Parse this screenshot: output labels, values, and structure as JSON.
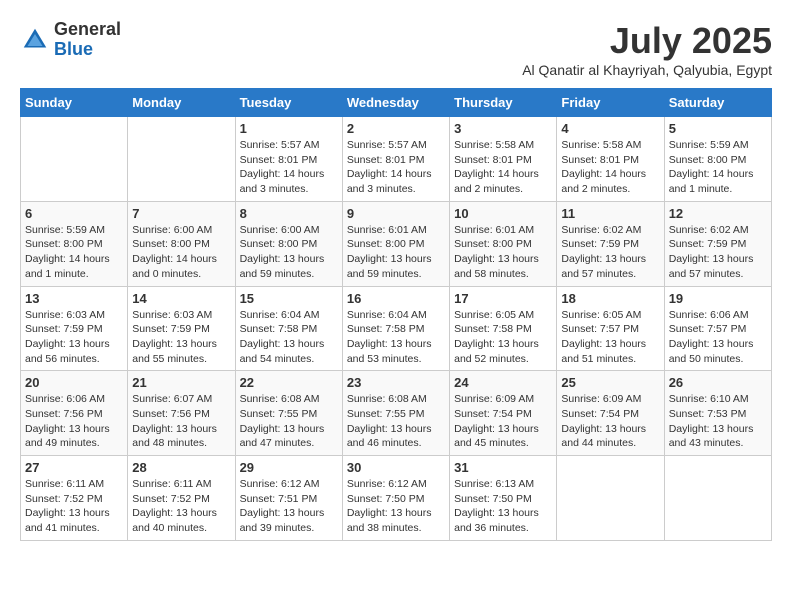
{
  "header": {
    "logo_general": "General",
    "logo_blue": "Blue",
    "month": "July 2025",
    "location": "Al Qanatir al Khayriyah, Qalyubia, Egypt"
  },
  "days_of_week": [
    "Sunday",
    "Monday",
    "Tuesday",
    "Wednesday",
    "Thursday",
    "Friday",
    "Saturday"
  ],
  "weeks": [
    [
      {
        "day": "",
        "info": ""
      },
      {
        "day": "",
        "info": ""
      },
      {
        "day": "1",
        "info": "Sunrise: 5:57 AM\nSunset: 8:01 PM\nDaylight: 14 hours and 3 minutes."
      },
      {
        "day": "2",
        "info": "Sunrise: 5:57 AM\nSunset: 8:01 PM\nDaylight: 14 hours and 3 minutes."
      },
      {
        "day": "3",
        "info": "Sunrise: 5:58 AM\nSunset: 8:01 PM\nDaylight: 14 hours and 2 minutes."
      },
      {
        "day": "4",
        "info": "Sunrise: 5:58 AM\nSunset: 8:01 PM\nDaylight: 14 hours and 2 minutes."
      },
      {
        "day": "5",
        "info": "Sunrise: 5:59 AM\nSunset: 8:00 PM\nDaylight: 14 hours and 1 minute."
      }
    ],
    [
      {
        "day": "6",
        "info": "Sunrise: 5:59 AM\nSunset: 8:00 PM\nDaylight: 14 hours and 1 minute."
      },
      {
        "day": "7",
        "info": "Sunrise: 6:00 AM\nSunset: 8:00 PM\nDaylight: 14 hours and 0 minutes."
      },
      {
        "day": "8",
        "info": "Sunrise: 6:00 AM\nSunset: 8:00 PM\nDaylight: 13 hours and 59 minutes."
      },
      {
        "day": "9",
        "info": "Sunrise: 6:01 AM\nSunset: 8:00 PM\nDaylight: 13 hours and 59 minutes."
      },
      {
        "day": "10",
        "info": "Sunrise: 6:01 AM\nSunset: 8:00 PM\nDaylight: 13 hours and 58 minutes."
      },
      {
        "day": "11",
        "info": "Sunrise: 6:02 AM\nSunset: 7:59 PM\nDaylight: 13 hours and 57 minutes."
      },
      {
        "day": "12",
        "info": "Sunrise: 6:02 AM\nSunset: 7:59 PM\nDaylight: 13 hours and 57 minutes."
      }
    ],
    [
      {
        "day": "13",
        "info": "Sunrise: 6:03 AM\nSunset: 7:59 PM\nDaylight: 13 hours and 56 minutes."
      },
      {
        "day": "14",
        "info": "Sunrise: 6:03 AM\nSunset: 7:59 PM\nDaylight: 13 hours and 55 minutes."
      },
      {
        "day": "15",
        "info": "Sunrise: 6:04 AM\nSunset: 7:58 PM\nDaylight: 13 hours and 54 minutes."
      },
      {
        "day": "16",
        "info": "Sunrise: 6:04 AM\nSunset: 7:58 PM\nDaylight: 13 hours and 53 minutes."
      },
      {
        "day": "17",
        "info": "Sunrise: 6:05 AM\nSunset: 7:58 PM\nDaylight: 13 hours and 52 minutes."
      },
      {
        "day": "18",
        "info": "Sunrise: 6:05 AM\nSunset: 7:57 PM\nDaylight: 13 hours and 51 minutes."
      },
      {
        "day": "19",
        "info": "Sunrise: 6:06 AM\nSunset: 7:57 PM\nDaylight: 13 hours and 50 minutes."
      }
    ],
    [
      {
        "day": "20",
        "info": "Sunrise: 6:06 AM\nSunset: 7:56 PM\nDaylight: 13 hours and 49 minutes."
      },
      {
        "day": "21",
        "info": "Sunrise: 6:07 AM\nSunset: 7:56 PM\nDaylight: 13 hours and 48 minutes."
      },
      {
        "day": "22",
        "info": "Sunrise: 6:08 AM\nSunset: 7:55 PM\nDaylight: 13 hours and 47 minutes."
      },
      {
        "day": "23",
        "info": "Sunrise: 6:08 AM\nSunset: 7:55 PM\nDaylight: 13 hours and 46 minutes."
      },
      {
        "day": "24",
        "info": "Sunrise: 6:09 AM\nSunset: 7:54 PM\nDaylight: 13 hours and 45 minutes."
      },
      {
        "day": "25",
        "info": "Sunrise: 6:09 AM\nSunset: 7:54 PM\nDaylight: 13 hours and 44 minutes."
      },
      {
        "day": "26",
        "info": "Sunrise: 6:10 AM\nSunset: 7:53 PM\nDaylight: 13 hours and 43 minutes."
      }
    ],
    [
      {
        "day": "27",
        "info": "Sunrise: 6:11 AM\nSunset: 7:52 PM\nDaylight: 13 hours and 41 minutes."
      },
      {
        "day": "28",
        "info": "Sunrise: 6:11 AM\nSunset: 7:52 PM\nDaylight: 13 hours and 40 minutes."
      },
      {
        "day": "29",
        "info": "Sunrise: 6:12 AM\nSunset: 7:51 PM\nDaylight: 13 hours and 39 minutes."
      },
      {
        "day": "30",
        "info": "Sunrise: 6:12 AM\nSunset: 7:50 PM\nDaylight: 13 hours and 38 minutes."
      },
      {
        "day": "31",
        "info": "Sunrise: 6:13 AM\nSunset: 7:50 PM\nDaylight: 13 hours and 36 minutes."
      },
      {
        "day": "",
        "info": ""
      },
      {
        "day": "",
        "info": ""
      }
    ]
  ]
}
